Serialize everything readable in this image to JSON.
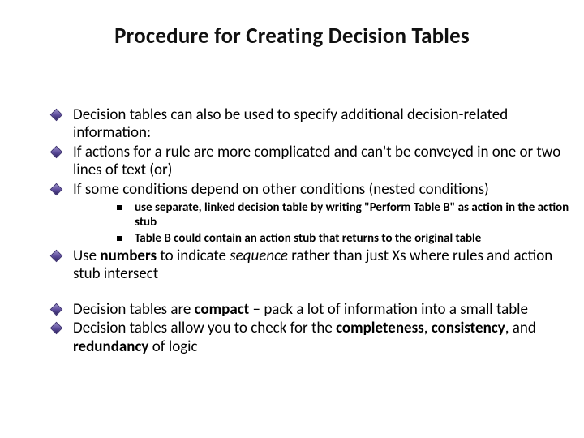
{
  "title": "Procedure for Creating Decision Tables",
  "bullets": {
    "b1": "Decision tables can also be used to specify additional decision-related information:",
    "b2": "If actions for a rule are more complicated and can't be conveyed in one or two lines of text (or)",
    "b3": "If some conditions depend on other conditions (nested conditions)",
    "b3_sub1": "use separate, linked decision table by writing \"Perform Table B\" as action in the action stub",
    "b3_sub2": "Table B could contain an action stub that returns to the original table",
    "b4_pre": "Use ",
    "b4_bold": "numbers",
    "b4_mid": " to indicate ",
    "b4_ital": "sequence",
    "b4_post": " rather than just Xs where rules and action stub intersect",
    "b5_pre": "Decision tables are ",
    "b5_bold": "compact",
    "b5_post": " – pack a lot of information into a small table",
    "b6_pre": "Decision tables allow you to check for the ",
    "b6_w1": "completeness",
    "b6_s1": ", ",
    "b6_w2": "consistency",
    "b6_s2": ", and ",
    "b6_w3": "redundancy",
    "b6_post": " of logic"
  }
}
